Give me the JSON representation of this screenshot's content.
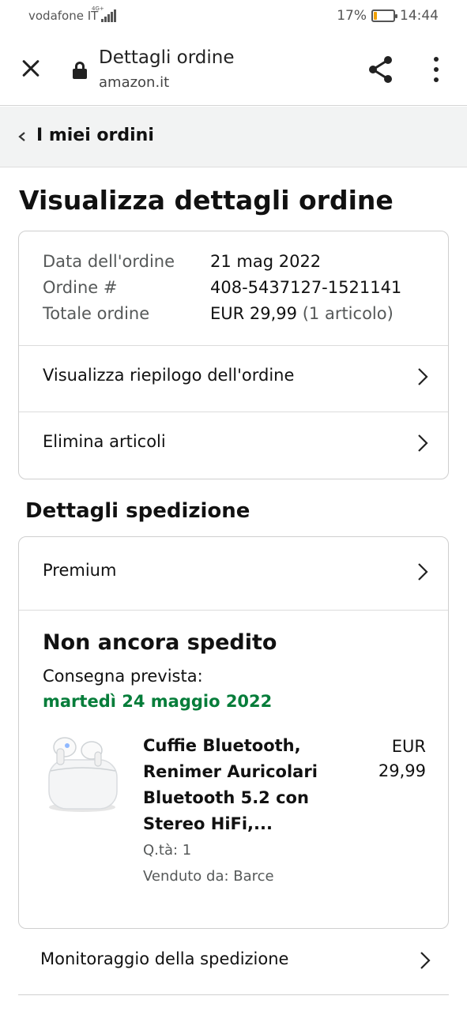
{
  "status_bar": {
    "carrier": "vodafone IT",
    "network": "4G+",
    "battery": "17%",
    "battery_level": 0.17,
    "time": "14:44"
  },
  "browser": {
    "title": "Dettagli ordine",
    "url": "amazon.it",
    "icons": [
      "close-icon",
      "lock-icon",
      "share-icon",
      "more-vert-icon"
    ]
  },
  "breadcrumb": {
    "label": "I miei ordini"
  },
  "page": {
    "title": "Visualizza dettagli ordine"
  },
  "order": {
    "rows": [
      {
        "label": "Data dell'ordine",
        "value": "21 mag 2022",
        "extra": ""
      },
      {
        "label": "Ordine #",
        "value": "408-5437127-1521141",
        "extra": ""
      },
      {
        "label": "Totale ordine",
        "value": "EUR 29,99",
        "extra": "(1 articolo)"
      }
    ],
    "links": [
      {
        "label": "Visualizza riepilogo dell'ordine"
      },
      {
        "label": "Elimina articoli"
      }
    ]
  },
  "shipping": {
    "section_title": "Dettagli spedizione",
    "method": "Premium",
    "status": "Non ancora spedito",
    "eta_label": "Consegna prevista:",
    "eta_date": "martedì 24 maggio 2022",
    "eta_color": "#067d3a",
    "item": {
      "name": "Cuffie Bluetooth, Renimer Auricolari Bluetooth 5.2 con Stereo HiFi,...",
      "price_currency": "EUR",
      "price_amount": "29,99",
      "qty": "Q.tà: 1",
      "seller": "Venduto da: Barce"
    },
    "tracking_label": "Monitoraggio della spedizione"
  }
}
